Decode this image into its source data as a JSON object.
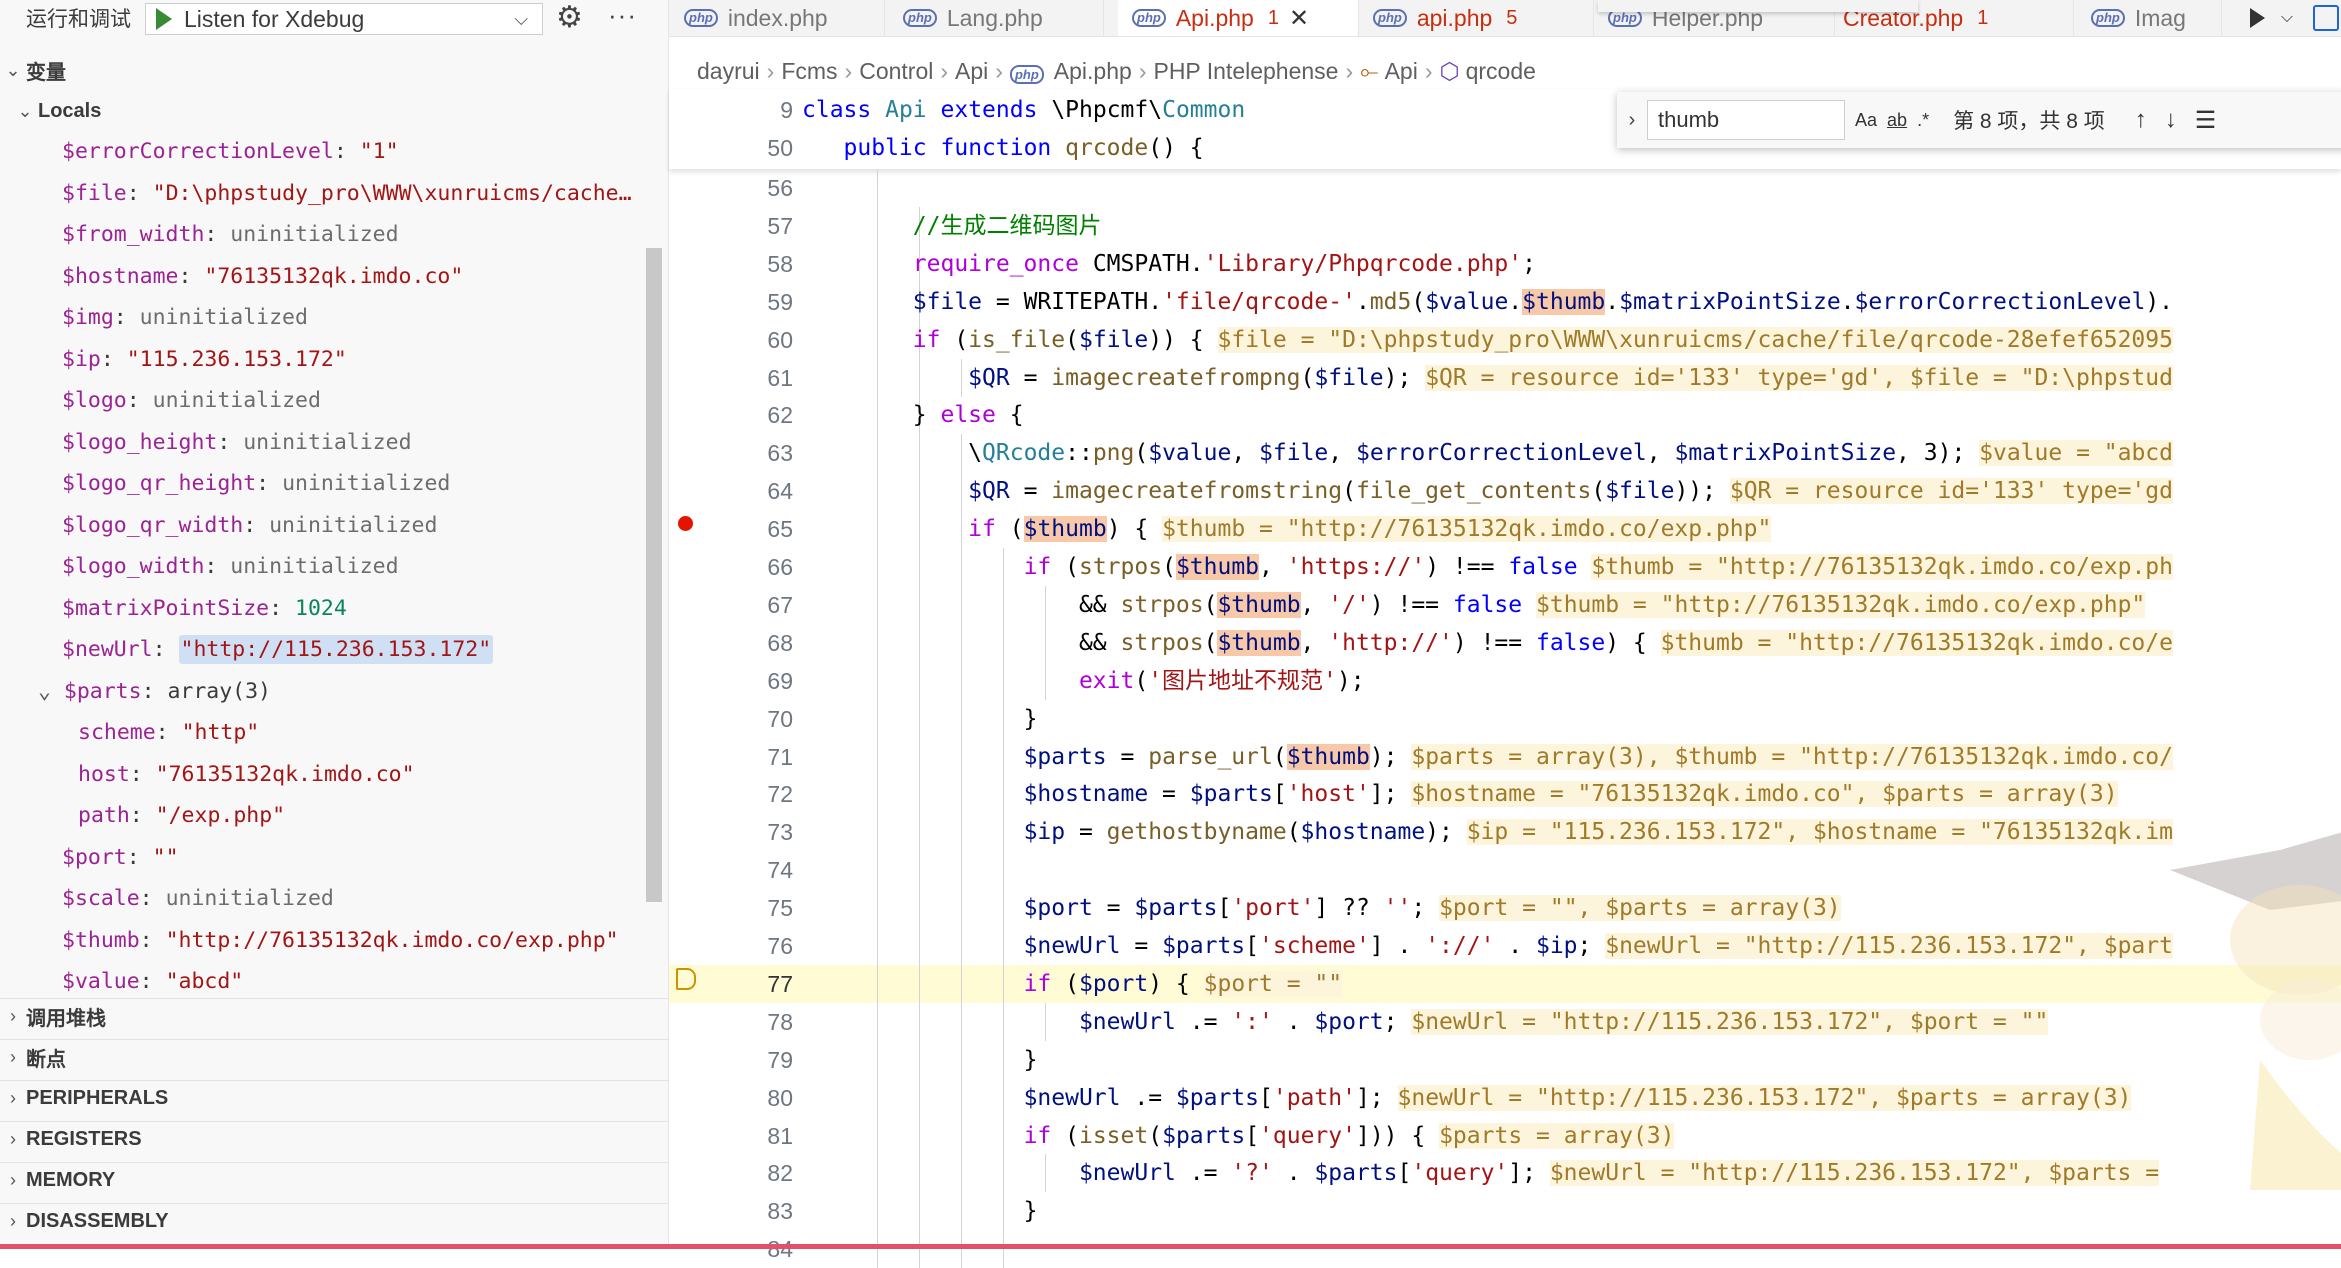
{
  "debug": {
    "title": "运行和调试",
    "config": "Listen for Xdebug"
  },
  "sections": {
    "variables": "变量",
    "locals": "Locals",
    "callstack": "调用堆栈",
    "breakpoints": "断点",
    "peripherals": "PERIPHERALS",
    "registers": "REGISTERS",
    "memory": "MEMORY",
    "disassembly": "DISASSEMBLY"
  },
  "variables": [
    {
      "name": "$errorCorrectionLevel",
      "value": "\"1\"",
      "kind": "str"
    },
    {
      "name": "$file",
      "value": "\"D:\\phpstudy_pro\\WWW\\xunruicms/cache…",
      "kind": "str"
    },
    {
      "name": "$from_width",
      "value": "uninitialized",
      "kind": "un"
    },
    {
      "name": "$hostname",
      "value": "\"76135132qk.imdo.co\"",
      "kind": "str"
    },
    {
      "name": "$img",
      "value": "uninitialized",
      "kind": "un"
    },
    {
      "name": "$ip",
      "value": "\"115.236.153.172\"",
      "kind": "str"
    },
    {
      "name": "$logo",
      "value": "uninitialized",
      "kind": "un"
    },
    {
      "name": "$logo_height",
      "value": "uninitialized",
      "kind": "un"
    },
    {
      "name": "$logo_qr_height",
      "value": "uninitialized",
      "kind": "un"
    },
    {
      "name": "$logo_qr_width",
      "value": "uninitialized",
      "kind": "un"
    },
    {
      "name": "$logo_width",
      "value": "uninitialized",
      "kind": "un"
    },
    {
      "name": "$matrixPointSize",
      "value": "1024",
      "kind": "num"
    },
    {
      "name": "$newUrl",
      "value": "\"http://115.236.153.172\"",
      "kind": "str",
      "selected": true
    },
    {
      "name": "$parts",
      "value": "array(3)",
      "kind": "plain",
      "expanded": true
    },
    {
      "name": "scheme",
      "value": "\"http\"",
      "kind": "str",
      "child": true
    },
    {
      "name": "host",
      "value": "\"76135132qk.imdo.co\"",
      "kind": "str",
      "child": true
    },
    {
      "name": "path",
      "value": "\"/exp.php\"",
      "kind": "str",
      "child": true
    },
    {
      "name": "$port",
      "value": "\"\"",
      "kind": "str"
    },
    {
      "name": "$scale",
      "value": "uninitialized",
      "kind": "un"
    },
    {
      "name": "$thumb",
      "value": "\"http://76135132qk.imdo.co/exp.php\"",
      "kind": "str"
    },
    {
      "name": "$value",
      "value": "\"abcd\"",
      "kind": "str"
    }
  ],
  "tabs": [
    {
      "label": "index.php"
    },
    {
      "label": "Lang.php"
    },
    {
      "label": "Api.php",
      "count": "1",
      "active": true
    },
    {
      "label": "api.php",
      "count": "5"
    },
    {
      "label": "Helper.php"
    },
    {
      "label": "Creator.php",
      "count": "1"
    },
    {
      "label": "Imag"
    }
  ],
  "breadcrumb": [
    "dayrui",
    "Fcms",
    "Control",
    "Api",
    "Api.php",
    "PHP Intelephense",
    "Api",
    "qrcode"
  ],
  "find": {
    "query": "thumb",
    "case_label": "Aa",
    "word_label": "ab",
    "regex_label": ".*",
    "count": "第 8 项，共 8 项"
  },
  "code": {
    "sticky": [
      {
        "num": "9",
        "text": "class Api extends \\Phpcmf\\Common"
      },
      {
        "num": "50",
        "text": "    public function qrcode() {"
      }
    ],
    "lines": [
      {
        "num": "56"
      },
      {
        "num": "57"
      },
      {
        "num": "58"
      },
      {
        "num": "59"
      },
      {
        "num": "60"
      },
      {
        "num": "61"
      },
      {
        "num": "62"
      },
      {
        "num": "63"
      },
      {
        "num": "64"
      },
      {
        "num": "65"
      },
      {
        "num": "66"
      },
      {
        "num": "67"
      },
      {
        "num": "68"
      },
      {
        "num": "69"
      },
      {
        "num": "70"
      },
      {
        "num": "71"
      },
      {
        "num": "72"
      },
      {
        "num": "73"
      },
      {
        "num": "74"
      },
      {
        "num": "75"
      },
      {
        "num": "76"
      },
      {
        "num": "77",
        "current": true
      },
      {
        "num": "78"
      },
      {
        "num": "79"
      },
      {
        "num": "80"
      },
      {
        "num": "81"
      },
      {
        "num": "82"
      },
      {
        "num": "83"
      },
      {
        "num": "84"
      }
    ]
  },
  "text": {
    "comment": "//生成二维码图片",
    "exit_msg": "'图片地址不规范'",
    "l60_inline": "$file = \"D:\\phpstudy_pro\\WWW\\xunruicms/cache/file/qrcode-28efef652095",
    "l61_inline": "$QR = resource id='133' type='gd', $file = \"D:\\phpstud",
    "l63_inline": "$value = \"abcd",
    "l64_inline": "$QR = resource id='133' type='gd",
    "l65_inline": "$thumb = \"http://76135132qk.imdo.co/exp.php\"",
    "l66_inline": "$thumb = \"http://76135132qk.imdo.co/exp.ph",
    "l67_inline": "$thumb = \"http://76135132qk.imdo.co/exp.php\"",
    "l68_inline": "$thumb = \"http://76135132qk.imdo.co/e",
    "l71_inline": "$parts = array(3), $thumb = \"http://76135132qk.imdo.co/",
    "l72_inline": "$hostname = \"76135132qk.imdo.co\", $parts = array(3)",
    "l73_inline": "$ip = \"115.236.153.172\", $hostname = \"76135132qk.im",
    "l75_inline": "$port = \"\", $parts = array(3)",
    "l76_inline": "$newUrl = \"http://115.236.153.172\", $part",
    "l77_inline": "$port = \"\"",
    "l78_inline": "$newUrl = \"http://115.236.153.172\", $port = \"\"",
    "l80_inline": "$newUrl = \"http://115.236.153.172\", $parts = array(3)",
    "l81_inline": "$parts = array(3)",
    "l82_inline": "$newUrl = \"http://115.236.153.172\", $parts ="
  }
}
